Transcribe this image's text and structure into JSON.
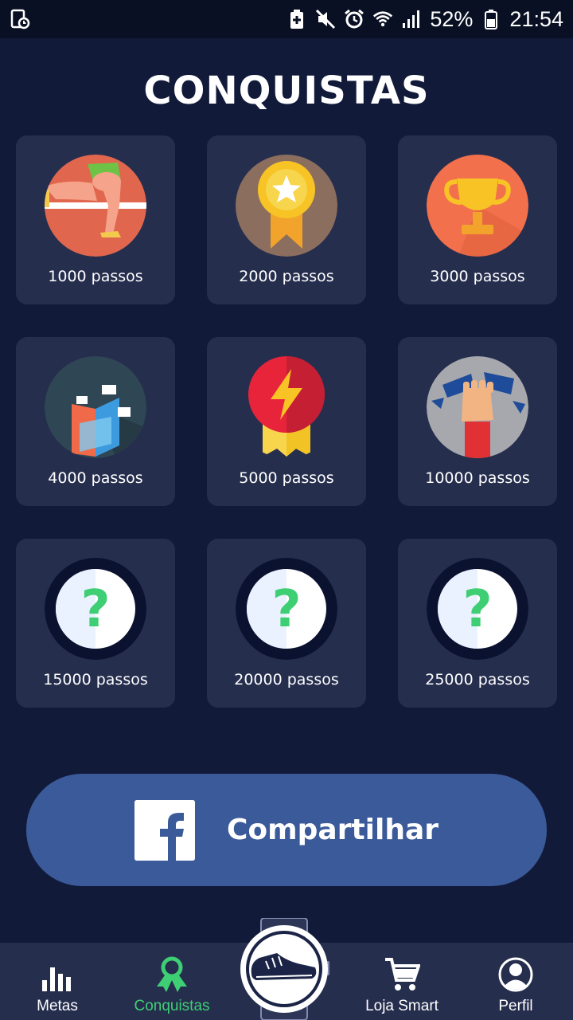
{
  "status_bar": {
    "battery": "52%",
    "time": "21:54"
  },
  "title": "CONQUISTAS",
  "achievements": [
    {
      "label": "1000 passos",
      "icon": "runner-icon",
      "unlocked": true
    },
    {
      "label": "2000 passos",
      "icon": "star-medal-icon",
      "unlocked": true
    },
    {
      "label": "3000 passos",
      "icon": "trophy-icon",
      "unlocked": true
    },
    {
      "label": "4000 passos",
      "icon": "finish-flags-icon",
      "unlocked": true
    },
    {
      "label": "5000 passos",
      "icon": "lightning-medal-icon",
      "unlocked": true
    },
    {
      "label": "10000 passos",
      "icon": "fist-breaking-icon",
      "unlocked": true
    },
    {
      "label": "15000 passos",
      "icon": "question-icon",
      "unlocked": false
    },
    {
      "label": "20000 passos",
      "icon": "question-icon",
      "unlocked": false
    },
    {
      "label": "25000 passos",
      "icon": "question-icon",
      "unlocked": false
    }
  ],
  "share_button": {
    "label": "Compartilhar",
    "icon": "facebook-icon"
  },
  "nav": {
    "items": [
      {
        "label": "Metas",
        "icon": "bar-chart-icon"
      },
      {
        "label": "Conquistas",
        "icon": "award-ribbon-icon",
        "active": true
      },
      {
        "label": "",
        "icon": "shoe-watch-icon"
      },
      {
        "label": "Loja Smart",
        "icon": "shopping-cart-icon"
      },
      {
        "label": "Perfil",
        "icon": "profile-icon"
      }
    ]
  },
  "colors": {
    "background": "#121a3a",
    "card": "#262e4e",
    "accent_green": "#3ecf74",
    "facebook_blue": "#3b5a9a"
  }
}
